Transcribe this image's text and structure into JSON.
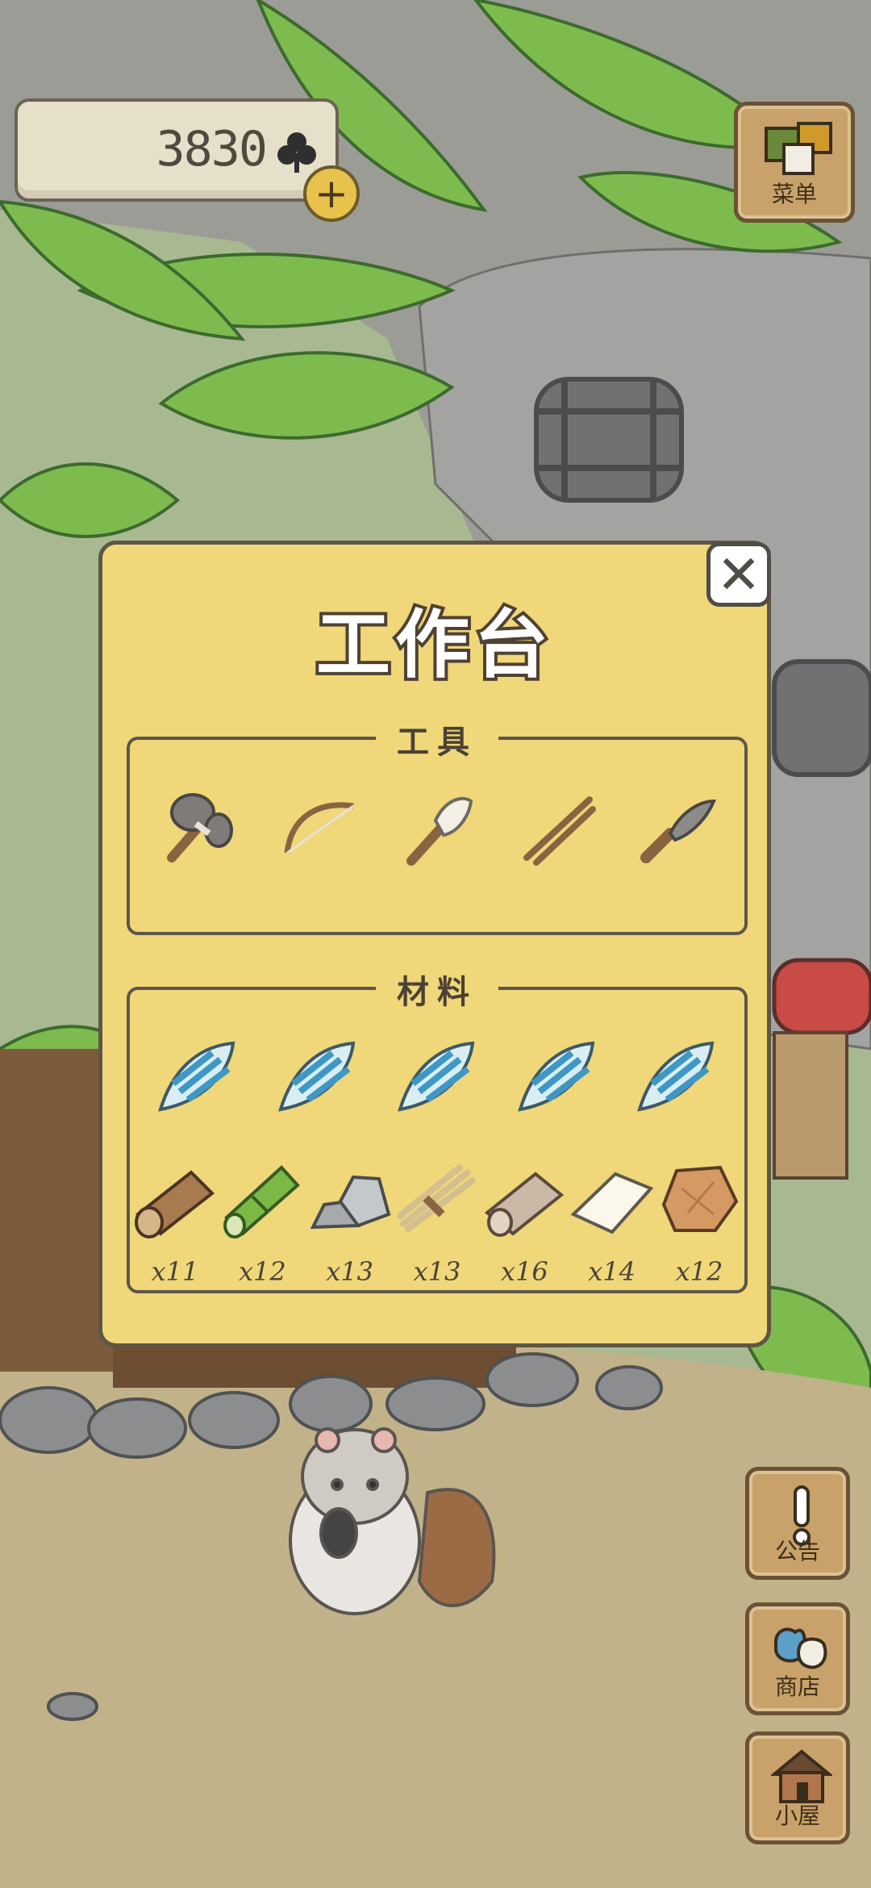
{
  "currency": {
    "amount": "3830",
    "icon": "clover-icon",
    "add_label": "+"
  },
  "menu_button": {
    "label": "菜单"
  },
  "notice_button": {
    "label": "公告"
  },
  "shop_button": {
    "label": "商店"
  },
  "house_button": {
    "label": "小屋"
  },
  "dialog": {
    "title": "工作台",
    "close_label": "✕",
    "tools_section": {
      "title": "工具",
      "items": [
        {
          "name": "stone-hammer-icon"
        },
        {
          "name": "bow-icon"
        },
        {
          "name": "feather-brush-icon"
        },
        {
          "name": "chopsticks-icon"
        },
        {
          "name": "knife-icon"
        }
      ]
    },
    "materials_section": {
      "title": "材料",
      "shells": [
        "shell-icon",
        "shell-icon",
        "shell-icon",
        "shell-icon",
        "shell-icon"
      ],
      "items": [
        {
          "name": "wood-log-icon",
          "qty": "x11"
        },
        {
          "name": "bamboo-icon",
          "qty": "x12"
        },
        {
          "name": "stones-icon",
          "qty": "x13"
        },
        {
          "name": "straw-bundle-icon",
          "qty": "x13"
        },
        {
          "name": "cloth-roll-icon",
          "qty": "x16"
        },
        {
          "name": "paper-icon",
          "qty": "x14"
        },
        {
          "name": "leather-icon",
          "qty": "x12"
        }
      ]
    }
  }
}
